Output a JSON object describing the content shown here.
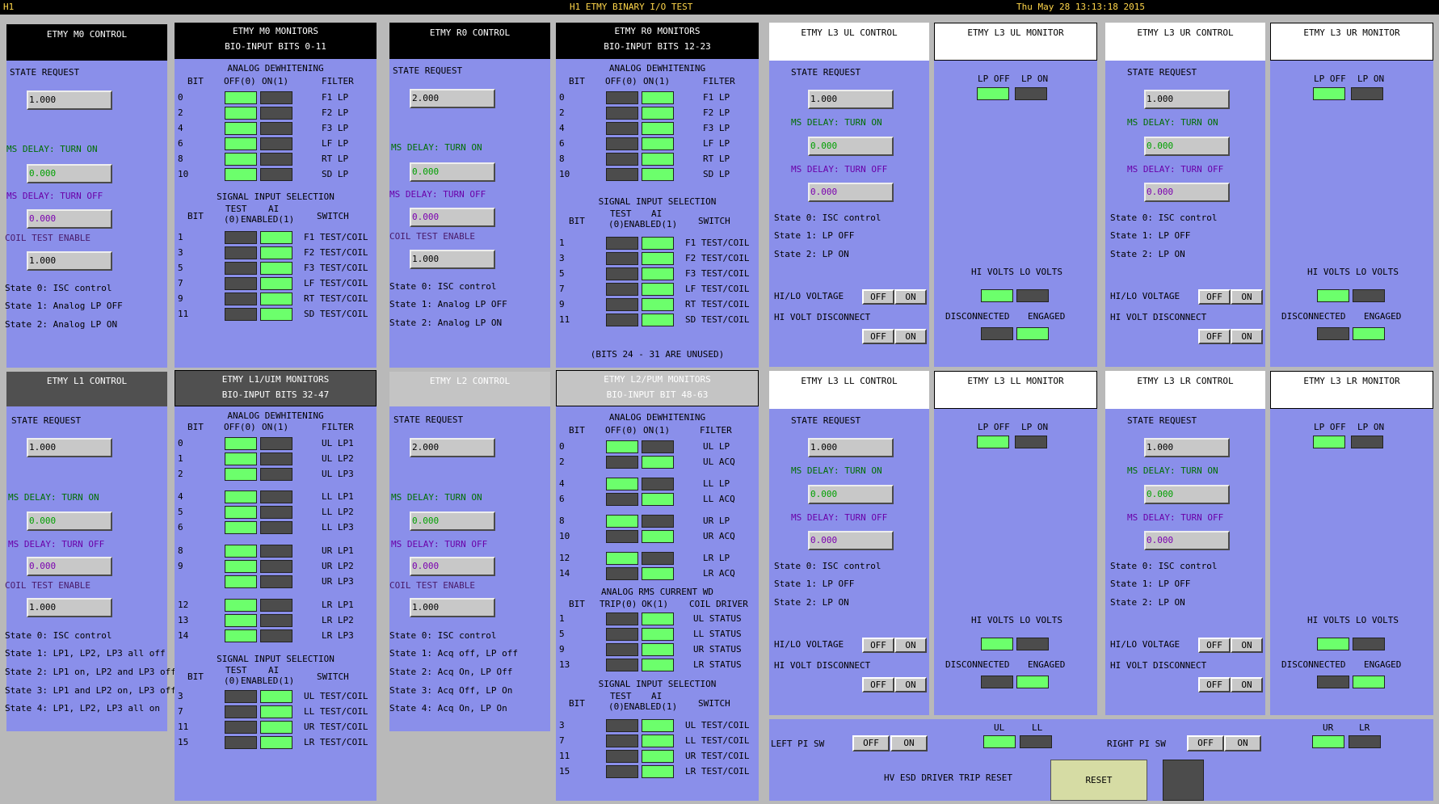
{
  "topbar": {
    "left": "H1",
    "title": "H1 ETMY BINARY I/O TEST",
    "datetime": "Thu May 28 13:13:18 2015"
  },
  "m0ctrl": {
    "title": "ETMY M0 CONTROL",
    "state_request": "STATE REQUEST",
    "state_value": "1.000",
    "delay_on": "MS DELAY: TURN ON",
    "delay_on_value": "0.000",
    "delay_off": "MS DELAY: TURN OFF",
    "delay_off_value": "0.000",
    "coil": "COIL TEST ENABLE",
    "coil_value": "1.000",
    "states": [
      "State 0: ISC control",
      "State 1: Analog LP OFF",
      "State 2: Analog LP ON"
    ]
  },
  "m0mon": {
    "title": "ETMY M0 MONITORS",
    "subtitle": "BIO-INPUT BITS 0-11",
    "aw": "ANALOG DEWHITENING",
    "bit": "BIT",
    "off": "OFF(0)",
    "on": "ON(1)",
    "filter": "FILTER",
    "bits": [
      "0",
      "2",
      "4",
      "6",
      "8",
      "10"
    ],
    "filters": [
      "F1 LP",
      "F2 LP",
      "F3 LP",
      "LF LP",
      "RT LP",
      "SD LP"
    ],
    "sis": "SIGNAL INPUT SELECTION",
    "test": "TEST",
    "zero": "(0)",
    "ai": "AI",
    "en": "ENABLED(1)",
    "switch": "SWITCH",
    "sbits": [
      "1",
      "3",
      "5",
      "7",
      "9",
      "11"
    ],
    "switches": [
      "F1 TEST/COIL",
      "F2 TEST/COIL",
      "F3 TEST/COIL",
      "LF TEST/COIL",
      "RT TEST/COIL",
      "SD TEST/COIL"
    ]
  },
  "r0ctrl": {
    "title": "ETMY R0 CONTROL",
    "state_request": "STATE REQUEST",
    "state_value": "2.000",
    "delay_on": "MS DELAY: TURN ON",
    "delay_on_value": "0.000",
    "delay_off": "MS DELAY: TURN OFF",
    "delay_off_value": "0.000",
    "coil": "COIL TEST ENABLE",
    "coil_value": "1.000",
    "states": [
      "State 0: ISC control",
      "State 1: Analog LP OFF",
      "State 2: Analog LP ON"
    ]
  },
  "r0mon": {
    "title": "ETMY R0 MONITORS",
    "subtitle": "BIO-INPUT BITS 12-23",
    "aw": "ANALOG DEWHITENING",
    "bit": "BIT",
    "off": "OFF(0)",
    "on": "ON(1)",
    "filter": "FILTER",
    "bits": [
      "0",
      "2",
      "4",
      "6",
      "8",
      "10"
    ],
    "filters": [
      "F1 LP",
      "F2 LP",
      "F3 LP",
      "LF LP",
      "RT LP",
      "SD LP"
    ],
    "sis": "SIGNAL INPUT SELECTION",
    "test": "TEST",
    "zero": "(0)",
    "ai": "AI",
    "en": "ENABLED(1)",
    "switch": "SWITCH",
    "sbits": [
      "1",
      "3",
      "5",
      "7",
      "9",
      "11"
    ],
    "switches": [
      "F1 TEST/COIL",
      "F2 TEST/COIL",
      "F3 TEST/COIL",
      "LF TEST/COIL",
      "RT TEST/COIL",
      "SD TEST/COIL"
    ],
    "unused": "(BITS 24 - 31 ARE UNUSED)"
  },
  "l1ctrl": {
    "title": "ETMY L1 CONTROL",
    "state_request": "STATE REQUEST",
    "state_value": "1.000",
    "delay_on": "MS DELAY: TURN ON",
    "delay_on_value": "0.000",
    "delay_off": "MS DELAY: TURN OFF",
    "delay_off_value": "0.000",
    "coil": "COIL TEST ENABLE",
    "coil_value": "1.000",
    "states": [
      "State 0: ISC control",
      "State 1: LP1, LP2, LP3 all off",
      "State 2: LP1 on, LP2 and LP3 off",
      "State 3: LP1 and LP2 on, LP3 off",
      "State 4: LP1, LP2, LP3 all on"
    ]
  },
  "l1mon": {
    "title": "ETMY L1/UIM MONITORS",
    "subtitle": "BIO-INPUT BITS 32-47",
    "aw": "ANALOG DEWHITENING",
    "bit": "BIT",
    "off": "OFF(0)",
    "on": "ON(1)",
    "filter": "FILTER",
    "bits": [
      "0",
      "1",
      "2",
      "4",
      "5",
      "6",
      "8",
      "9",
      "",
      "12",
      "13",
      "14"
    ],
    "filters": [
      "UL LP1",
      "UL LP2",
      "UL LP3",
      "LL LP1",
      "LL LP2",
      "LL LP3",
      "UR LP1",
      "UR LP2",
      "UR LP3",
      "LR LP1",
      "LR LP2",
      "LR LP3"
    ],
    "sis": "SIGNAL INPUT SELECTION",
    "test": "TEST",
    "zero": "(0)",
    "ai": "AI",
    "en": "ENABLED(1)",
    "switch": "SWITCH",
    "sbits": [
      "3",
      "7",
      "11",
      "15"
    ],
    "switches": [
      "UL TEST/COIL",
      "LL TEST/COIL",
      "UR TEST/COIL",
      "LR TEST/COIL"
    ]
  },
  "l2ctrl": {
    "title": "ETMY L2 CONTROL",
    "state_request": "STATE REQUEST",
    "state_value": "2.000",
    "delay_on": "MS DELAY: TURN ON",
    "delay_on_value": "0.000",
    "delay_off": "MS DELAY: TURN OFF",
    "delay_off_value": "0.000",
    "coil": "COIL TEST ENABLE",
    "coil_value": "1.000",
    "states": [
      "State 0: ISC control",
      "State 1: Acq off, LP off",
      "State 2: Acq On, LP Off",
      "State 3: Acq Off, LP On",
      "State 4: Acq On, LP On"
    ]
  },
  "l2mon": {
    "title": "ETMY L2/PUM MONITORS",
    "subtitle": "BIO-INPUT BIT 48-63",
    "aw": "ANALOG DEWHITENING",
    "bit": "BIT",
    "off": "OFF(0)",
    "on": "ON(1)",
    "filter": "FILTER",
    "bits": [
      "0",
      "2",
      "4",
      "6",
      "8",
      "10",
      "12",
      "14"
    ],
    "filters": [
      "UL LP",
      "UL ACQ",
      "LL LP",
      "LL ACQ",
      "UR LP",
      "UR ACQ",
      "LR LP",
      "LR ACQ"
    ],
    "rms": "ANALOG RMS CURRENT WD",
    "trip": "TRIP(0)",
    "ok": "OK(1)",
    "coildrv": "COIL DRIVER",
    "rbits": [
      "1",
      "5",
      "9",
      "13"
    ],
    "rnames": [
      "UL STATUS",
      "LL STATUS",
      "UR STATUS",
      "LR STATUS"
    ],
    "sis": "SIGNAL INPUT SELECTION",
    "test": "TEST",
    "zero": "(0)",
    "ai": "AI",
    "en": "ENABLED(1)",
    "switch": "SWITCH",
    "sbits": [
      "3",
      "7",
      "11",
      "15"
    ],
    "switches": [
      "UL TEST/COIL",
      "LL TEST/COIL",
      "UR TEST/COIL",
      "LR TEST/COIL"
    ]
  },
  "l3": {
    "ul": {
      "title": "ETMY L3 UL CONTROL",
      "mon": "ETMY L3 UL MONITOR"
    },
    "ur": {
      "title": "ETMY L3 UR CONTROL",
      "mon": "ETMY L3 UR MONITOR"
    },
    "ll": {
      "title": "ETMY L3 LL CONTROL",
      "mon": "ETMY L3 LL MONITOR"
    },
    "lr": {
      "title": "ETMY L3 LR CONTROL",
      "mon": "ETMY L3 LR MONITOR"
    },
    "state_request": "STATE REQUEST",
    "state_value": "1.000",
    "delay_on": "MS DELAY: TURN ON",
    "delay_on_value": "0.000",
    "delay_off": "MS DELAY: TURN OFF",
    "delay_off_value": "0.000",
    "states": [
      "State 0: ISC control",
      "State 1: LP OFF",
      "State 2: LP ON"
    ],
    "hilo": "HI/LO VOLTAGE",
    "hvdisc": "HI VOLT DISCONNECT",
    "off": "OFF",
    "on": "ON",
    "lpoff": "LP OFF",
    "lpon": "LP ON",
    "hivolts": "HI VOLTS",
    "lovolts": "LO VOLTS",
    "disconnected": "DISCONNECTED",
    "engaged": "ENGAGED"
  },
  "bottom": {
    "leftpi": "LEFT PI SW",
    "rightpi": "RIGHT PI SW",
    "off": "OFF",
    "on": "ON",
    "ul": "UL",
    "ll": "LL",
    "ur": "UR",
    "lr": "LR",
    "esd": "HV ESD DRIVER TRIP RESET",
    "reset": "RESET"
  },
  "colors": {
    "panel": "#8a8fea",
    "led_on": "#6cff6c",
    "led_off": "#4c4c4c",
    "background": "#b9b9b9"
  }
}
